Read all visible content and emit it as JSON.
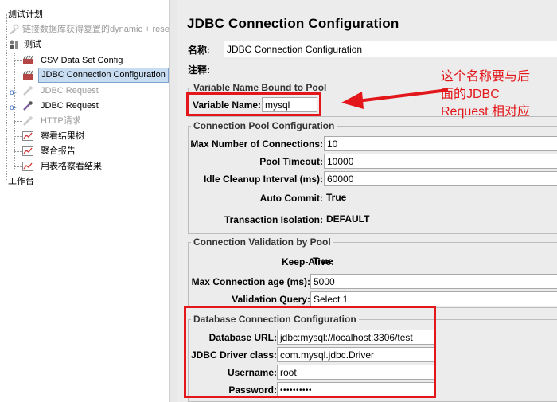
{
  "tree": {
    "test_plan": "测试计划",
    "db_link_item": "链接数据库获得复置的dynamic + rese",
    "thread_group": "测试",
    "csv_config": "CSV Data Set Config",
    "jdbc_config": "JDBC Connection Configuration",
    "jdbc_request_disabled": "JDBC Request",
    "jdbc_request": "JDBC Request",
    "http_request": "HTTP请求",
    "view_results_tree": "察看结果树",
    "aggregate_report": "聚合报告",
    "view_results_table": "用表格察看结果",
    "workbench": "工作台"
  },
  "panel": {
    "title": "JDBC Connection Configuration",
    "name_label": "名称:",
    "name_value": "JDBC Connection Configuration",
    "comment_label": "注释:",
    "comment_value": "",
    "var_group_legend": "Variable Name Bound to Pool",
    "var_name_label": "Variable Name:",
    "var_name_value": "mysql",
    "pool_group_legend": "Connection Pool Configuration",
    "max_conn_label": "Max Number of Connections:",
    "max_conn_value": "10",
    "pool_timeout_label": "Pool Timeout:",
    "pool_timeout_value": "10000",
    "idle_label": "Idle Cleanup Interval (ms):",
    "idle_value": "60000",
    "auto_commit_label": "Auto Commit:",
    "auto_commit_value": "True",
    "tx_label": "Transaction Isolation:",
    "tx_value": "DEFAULT",
    "validation_group_legend": "Connection Validation by Pool",
    "keepalive_label": "Keep-Alive:",
    "keepalive_value": "True",
    "max_age_label": "Max Connection age (ms):",
    "max_age_value": "5000",
    "vquery_label": "Validation Query:",
    "vquery_value": "Select 1",
    "db_group_legend": "Database Connection Configuration",
    "url_label": "Database URL:",
    "url_value": "jdbc:mysql://localhost:3306/test",
    "driver_label": "JDBC Driver class:",
    "driver_value": "com.mysql.jdbc.Driver",
    "user_label": "Username:",
    "user_value": "root",
    "pass_label": "Password:",
    "pass_value": "••••••••••"
  },
  "annotation": {
    "line1": "这个名称要与后",
    "line2": "面的JDBC",
    "line3": "Request 相对应"
  },
  "colors": {
    "annotation_red": "#e3161a",
    "selection_bg": "#c8ddf2",
    "panel_bg": "#ececec"
  }
}
